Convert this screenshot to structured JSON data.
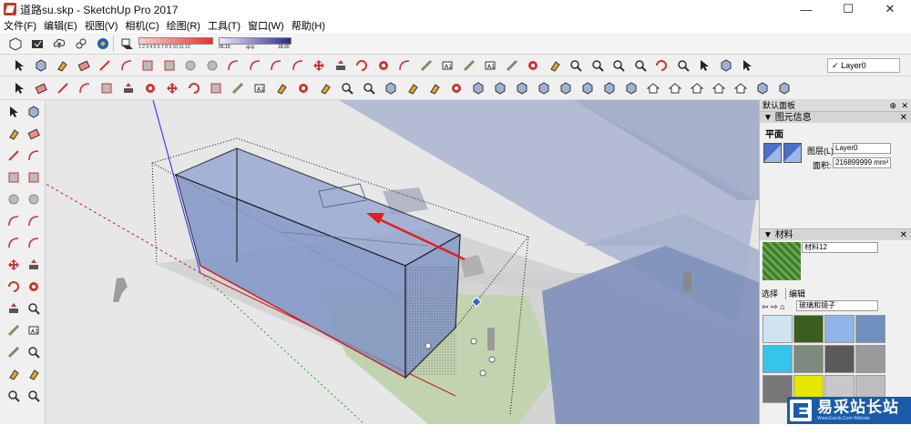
{
  "window": {
    "title": "道路su.skp - SketchUp Pro 2017",
    "minimize": "—",
    "maximize": "☐",
    "close": "✕"
  },
  "menu": [
    "文件(F)",
    "编辑(E)",
    "视图(V)",
    "相机(C)",
    "绘图(R)",
    "工具(T)",
    "窗口(W)",
    "帮助(H)"
  ],
  "shadow_toolbar": {
    "months": "1 2 3 4 5 6 7 8 9 10 11 12",
    "time_start": "05:19",
    "time_noon": "中午",
    "time_end": "18:20"
  },
  "layer_toolbar": {
    "check": "✓",
    "layer": "Layer0"
  },
  "tray": {
    "title": "默认面板",
    "entity_info": {
      "header": "图元信息",
      "type": "平面",
      "layer_label": "图层(L):",
      "layer_value": "Layer0",
      "area_label": "面积:",
      "area_value": "216899999 mm²"
    },
    "materials": {
      "header": "材料",
      "current": "材料12",
      "tab_select": "选择",
      "tab_edit": "编辑",
      "library": "玻璃和镜子",
      "swatches": [
        "#cfe3f2",
        "#3b5e1e",
        "#8fb4e8",
        "#6f8fbf",
        "#35c5ea",
        "#7e8a7e",
        "#5a5a5a",
        "#9a9a9a",
        "#777777",
        "#e6e600",
        "#c8c8c8",
        "#bdbdbd"
      ]
    }
  },
  "watermark": {
    "text": "易采站长站",
    "sub": "Www.Easck.Com Website"
  },
  "colors": {
    "selection_face": "#7b92c6",
    "glass_face": "#a8b6d8",
    "axis_red": "#d22020",
    "axis_blue": "#3030ff",
    "axis_green": "#20a020"
  }
}
